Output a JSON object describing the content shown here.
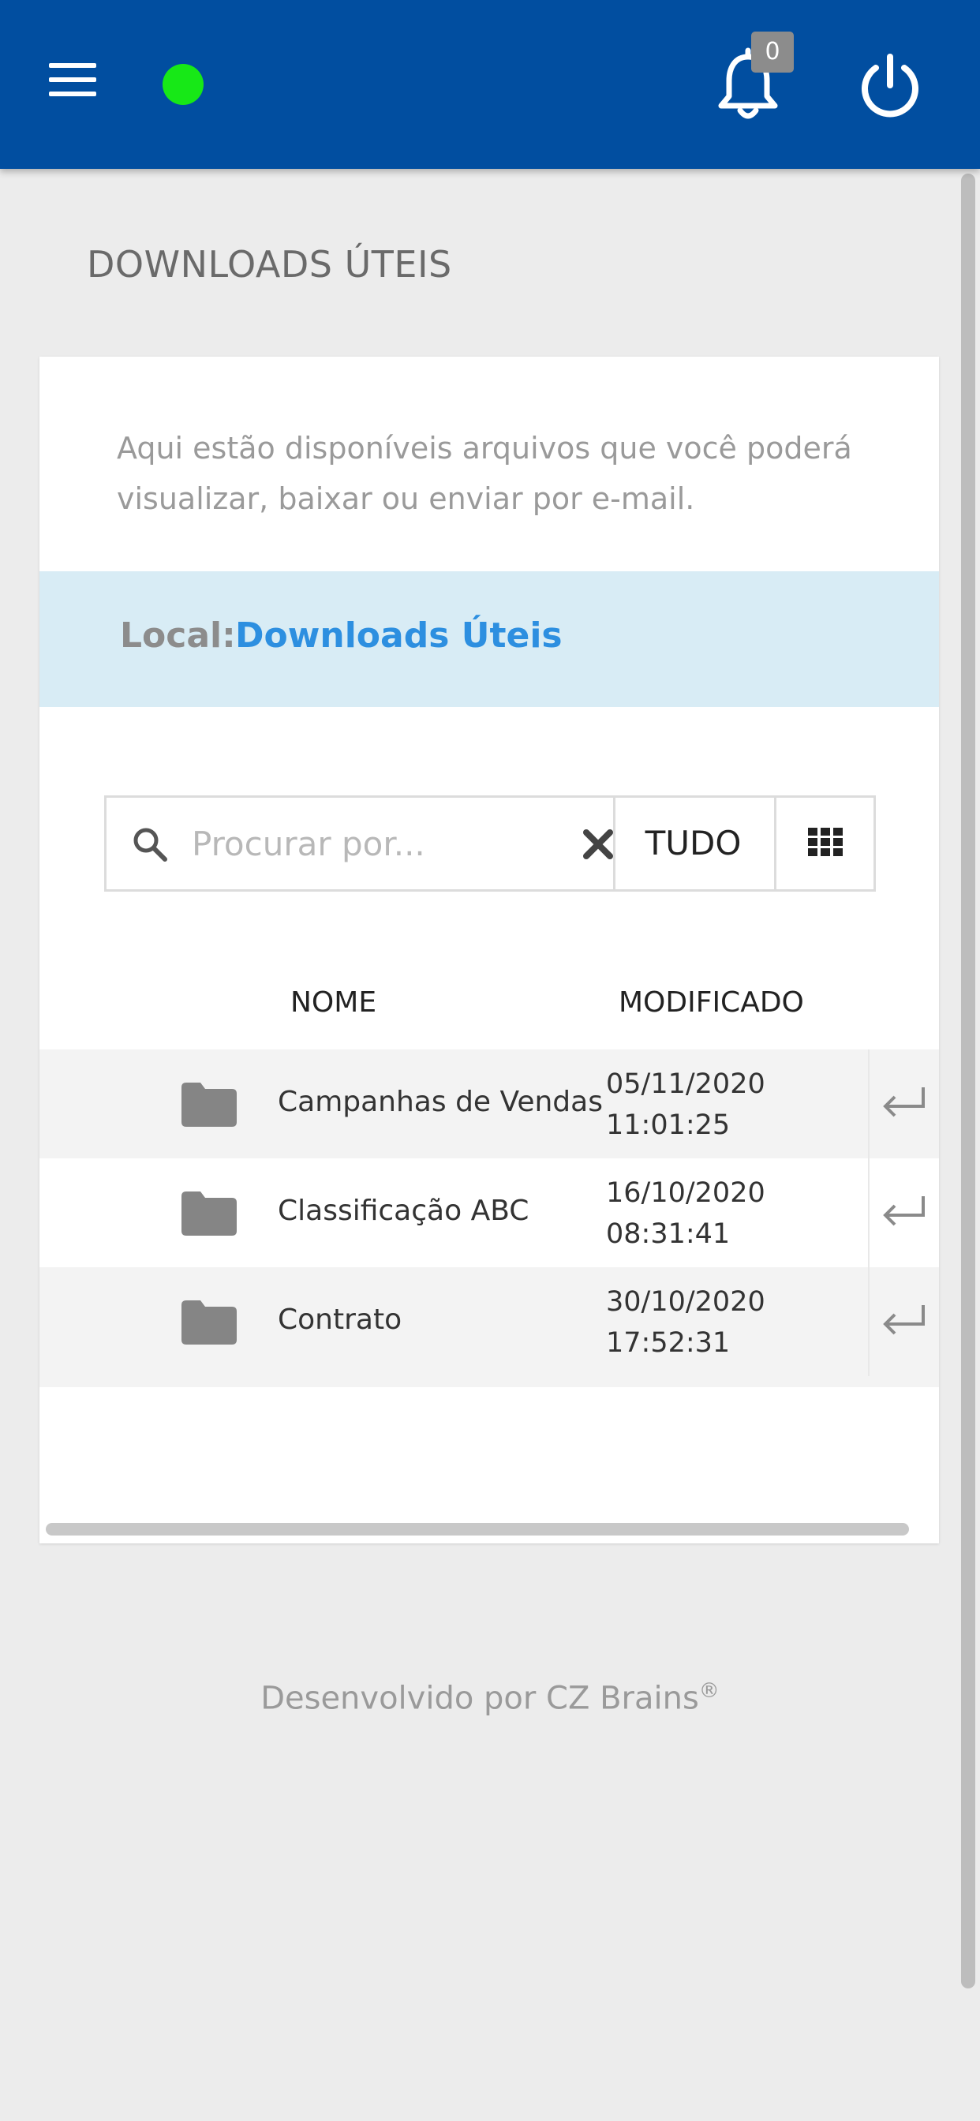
{
  "header": {
    "status_color": "#17e817",
    "notification_count": "0",
    "icons": [
      "menu-icon",
      "bell-icon",
      "power-icon"
    ]
  },
  "page": {
    "title": "DOWNLOADS ÚTEIS"
  },
  "card": {
    "description": "Aqui estão disponíveis arquivos que você poderá visualizar, baixar ou enviar por e-mail.",
    "location_label": "Local:",
    "location_value": "Downloads Úteis"
  },
  "search": {
    "placeholder": "Procurar por...",
    "value": "",
    "filter_label": "TUDO"
  },
  "table": {
    "columns": [
      "NOME",
      "MODIFICADO"
    ],
    "rows": [
      {
        "name": "Campanhas de Vendas",
        "date": "05/11/2020",
        "time": "11:01:25"
      },
      {
        "name": "Classificação ABC",
        "date": "16/10/2020",
        "time": "08:31:41"
      },
      {
        "name": "Contrato",
        "date": "30/10/2020",
        "time": "17:52:31"
      }
    ]
  },
  "footer": {
    "text": "Desenvolvido por CZ Brains",
    "mark": "®"
  },
  "colors": {
    "header_bg": "#014ea0",
    "location_bg": "#d8ecf5",
    "location_link": "#2d8fe0"
  }
}
